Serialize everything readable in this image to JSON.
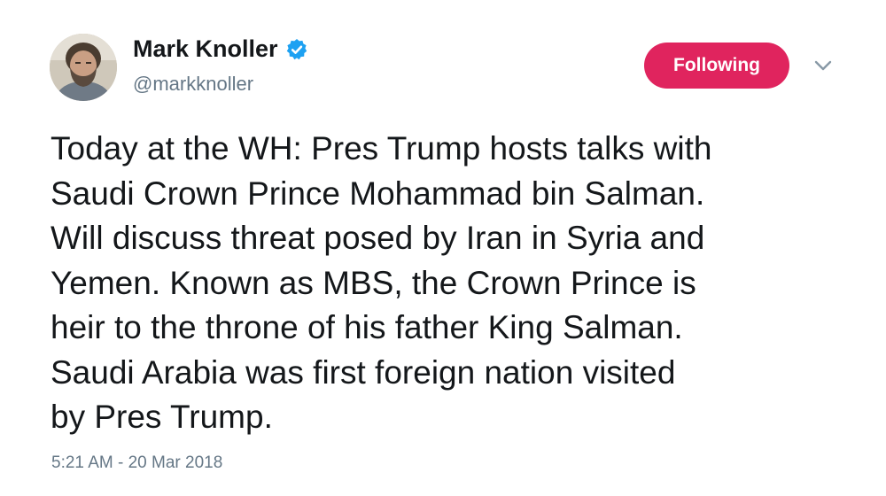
{
  "tweet": {
    "author": {
      "name": "Mark Knoller",
      "handle": "@markknoller",
      "verified": true,
      "avatar": "profile-photo"
    },
    "follow_button": {
      "label": "Following",
      "color": "#e0245e"
    },
    "menu_icon": "chevron-down-icon",
    "text": "Today at the WH: Pres Trump hosts talks with\nSaudi Crown Prince Mohammad bin Salman.\nWill discuss threat posed by Iran in Syria and\nYemen. Known as MBS, the Crown Prince is\nheir to the throne of his father King Salman.\nSaudi Arabia was first foreign nation visited\nby Pres Trump.",
    "timestamp": "5:21 AM - 20 Mar 2018"
  },
  "colors": {
    "verified_badge": "#1da1f2",
    "secondary_text": "#657786",
    "primary_text": "#14171a"
  }
}
